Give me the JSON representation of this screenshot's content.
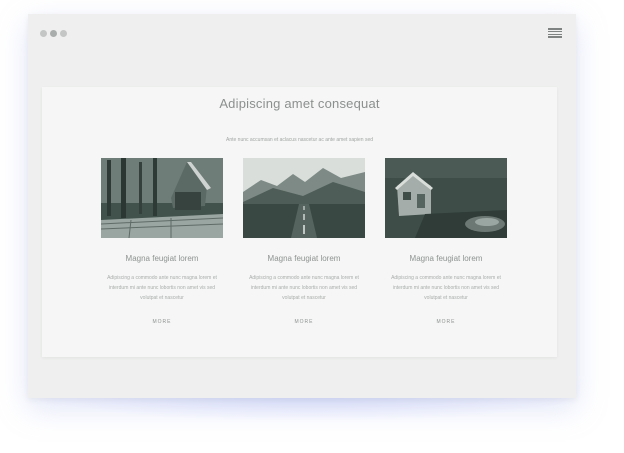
{
  "browser": {
    "menu_icon": "hamburger-icon",
    "dots": [
      "window-dot",
      "window-dot",
      "window-dot"
    ]
  },
  "page": {
    "title": "Adipiscing amet consequat",
    "subtitle": "Ante nunc accumsan et aclacus nascetur ac ante amet sapien sed"
  },
  "cards": [
    {
      "image": "forest-cabin-image",
      "title": "Magna feugiat lorem",
      "text": "Adipiscing a commodo ante nunc magna lorem et interdum mi ante nunc lobortis non amet vis sed volutpat et nascetur",
      "more": "MORE"
    },
    {
      "image": "mountain-road-image",
      "title": "Magna feugiat lorem",
      "text": "Adipiscing a commodo ante nunc magna lorem et interdum mi ante nunc lobortis non amet vis sed volutpat et nascetur",
      "more": "MORE"
    },
    {
      "image": "lakeside-hut-image",
      "title": "Magna feugiat lorem",
      "text": "Adipiscing a commodo ante nunc magna lorem et interdum mi ante nunc lobortis non amet vis sed volutpat et nascetur",
      "more": "MORE"
    }
  ],
  "colors": {
    "image_dark": "#3f4f4a",
    "background": "#eeefee",
    "text": "#8e9391"
  }
}
